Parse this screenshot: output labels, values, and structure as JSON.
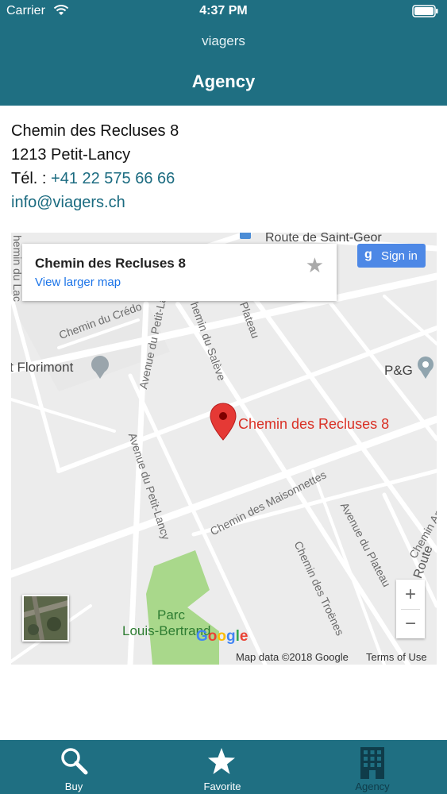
{
  "status": {
    "carrier": "Carrier",
    "time": "4:37 PM"
  },
  "header": {
    "app_name": "viagers",
    "title": "Agency"
  },
  "agency": {
    "street": "Chemin des Recluses 8",
    "city": "1213 Petit-Lancy",
    "phone_prefix": "Tél. : ",
    "phone": "+41 22 575 66 66",
    "email": "info@viagers.ch"
  },
  "map": {
    "info_card": {
      "title": "Chemin des Recluses 8",
      "link": "View larger map"
    },
    "sign_in": {
      "g": "g",
      "label": "Sign in"
    },
    "marker_label": "Chemin des Recluses 8",
    "streets": {
      "route_st_georges": "Route de Saint-Geor",
      "chemin_credo": "Chemin du Crédo",
      "florimont": "t Florimont",
      "pg": "P&G",
      "avenue_petit_lancy_1": "Avenue du Petit-La",
      "avenue_petit_lancy_2": "Avenue du Petit-Lancy",
      "chemin_saleve": "hemin du Salève",
      "plateau_top": "Plateau",
      "maisonnettes": "Chemin des Maisonnettes",
      "avenue_plateau": "Avenue du Plateau",
      "chemin_troenes": "Chemin des Troënes",
      "chemin_an": "Chemin An",
      "route_right": "Route",
      "left_edge": "hemin du Lac",
      "parc_1": "Parc",
      "parc_2": "Louis-Bertrand"
    },
    "zoom_in": "+",
    "zoom_out": "−",
    "google": [
      "G",
      "o",
      "o",
      "g",
      "l",
      "e"
    ],
    "map_data": "Map data ©2018 Google",
    "terms": "Terms of Use"
  },
  "tabs": [
    {
      "label": "Buy",
      "icon": "search-icon"
    },
    {
      "label": "Favorite",
      "icon": "star-icon"
    },
    {
      "label": "Agency",
      "icon": "building-icon",
      "selected": true
    }
  ],
  "colors": {
    "brand": "#1f6f82",
    "link": "#1b6b80",
    "marker": "#d93025",
    "selected_tab": "#0f3c4a"
  }
}
